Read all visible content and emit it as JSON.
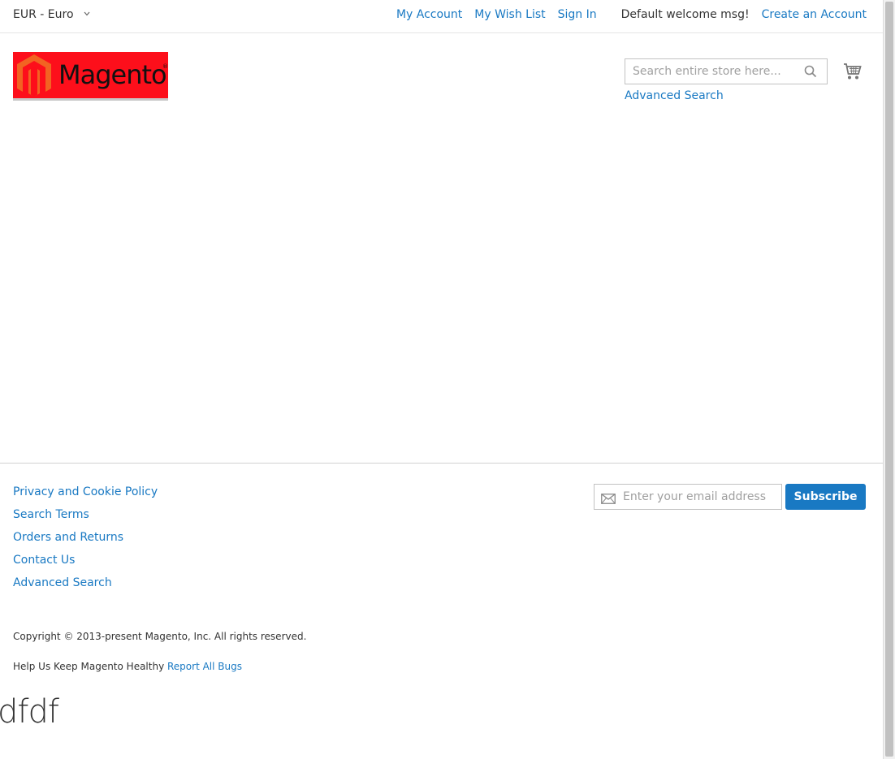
{
  "header": {
    "currency": "EUR - Euro",
    "links": {
      "my_account": "My Account",
      "wish_list": "My Wish List",
      "sign_in": "Sign In",
      "welcome": "Default welcome msg!",
      "create_account": "Create an Account"
    }
  },
  "logo": {
    "text": "Magento",
    "mark": "®",
    "bg_color": "#fd0f1b"
  },
  "search": {
    "placeholder": "Search entire store here...",
    "advanced_search": "Advanced Search"
  },
  "footer": {
    "links": [
      "Privacy and Cookie Policy",
      "Search Terms",
      "Orders and Returns",
      "Contact Us",
      "Advanced Search"
    ],
    "newsletter": {
      "placeholder": "Enter your email address",
      "button": "Subscribe"
    },
    "copyright": "Copyright © 2013-present Magento, Inc. All rights reserved.",
    "bugs_text": "Help Us Keep Magento Healthy",
    "bugs_link": "Report All Bugs",
    "stray_text": "dfdf"
  },
  "colors": {
    "link": "#1979c3",
    "button": "#1979c3",
    "logo_orange": "#f26322"
  },
  "icons": {
    "currency_toggle": "chevron-down-icon",
    "search": "search-icon",
    "cart": "cart-icon",
    "newsletter": "mail-icon"
  }
}
